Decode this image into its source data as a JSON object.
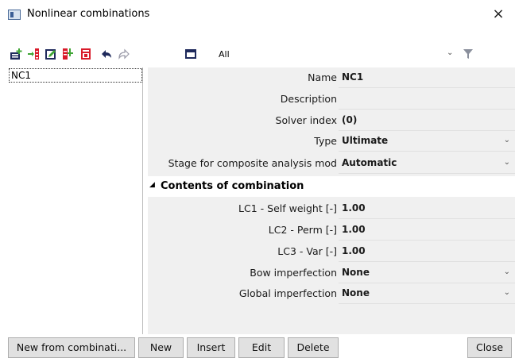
{
  "window": {
    "title": "Nonlinear combinations",
    "close_glyph": "×"
  },
  "toolbar": {
    "icons": [
      "new-icon",
      "insert-icon",
      "edit-icon",
      "copy-icon",
      "delete-icon",
      "undo-icon",
      "redo-icon",
      "maximize-icon"
    ],
    "filter_value": "All",
    "chevron": "⌄",
    "funnel_icon": "filter-icon"
  },
  "list": {
    "items": [
      "NC1"
    ]
  },
  "properties": {
    "name_label": "Name",
    "name_value": "NC1",
    "description_label": "Description",
    "description_value": "",
    "solver_label": "Solver index",
    "solver_value": "(0)",
    "type_label": "Type",
    "type_value": "Ultimate",
    "stage_label": "Stage for composite analysis mod",
    "stage_value": "Automatic",
    "section_title": "Contents of combination",
    "lc1_label": "LC1 - Self weight [-]",
    "lc1_value": "1.00",
    "lc2_label": "LC2 - Perm [-]",
    "lc2_value": "1.00",
    "lc3_label": "LC3 - Var [-]",
    "lc3_value": "1.00",
    "bow_label": "Bow imperfection",
    "bow_value": "None",
    "global_label": "Global imperfection",
    "global_value": "None",
    "dropdown_glyph": "⌄"
  },
  "buttons": {
    "new_from": "New from combinati...",
    "new": "New",
    "insert": "Insert",
    "edit": "Edit",
    "delete": "Delete",
    "close": "Close"
  },
  "colors": {
    "accent_red": "#d91a2a",
    "accent_green": "#3fa535",
    "accent_navy": "#1f2a5c",
    "grid_bg": "#f0f0f0",
    "button_bg": "#e1e1e1"
  }
}
